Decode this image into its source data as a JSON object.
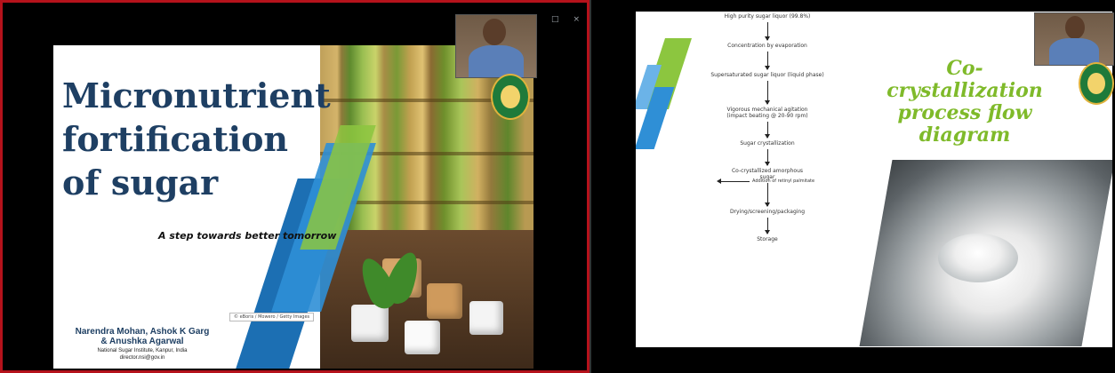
{
  "window_controls": {
    "minimize": "–",
    "maximize": "□",
    "close": "×"
  },
  "left_slide": {
    "title_lines": [
      "Micronutrient",
      "fortification",
      "of sugar"
    ],
    "subtitle": "A step towards better tomorrow",
    "image_caption": "© eBoris / Mowero / Getty Images",
    "authors_line1": "Narendra Mohan, Ashok K Garg",
    "authors_line2": "& Anushka Agarwal",
    "institute": "National Sugar Institute, Kanpur, India",
    "email": "director.nsi@gov.in"
  },
  "right_slide": {
    "title_lines": [
      "Co-crystallization",
      "process flow",
      "diagram"
    ],
    "flow_steps": [
      "High purity sugar liquor (99.8%)",
      "Concentration by evaporation",
      "Supersaturated sugar liquor (liquid phase)",
      "Vigorous mechanical agitation\n(impact beating @ 20-90 rpm)",
      "Sugar crystallization",
      "Co-crystallized amorphous\nsugar",
      "Drying/screening/packaging",
      "Storage"
    ],
    "side_note": "Addition of retinyl palmitate"
  },
  "colors": {
    "left_border": "#b5121b",
    "title_blue": "#1e3f63",
    "title_green": "#7fba2a",
    "stripe_blue": "#2f8fd6",
    "stripe_green": "#8cc63f"
  }
}
